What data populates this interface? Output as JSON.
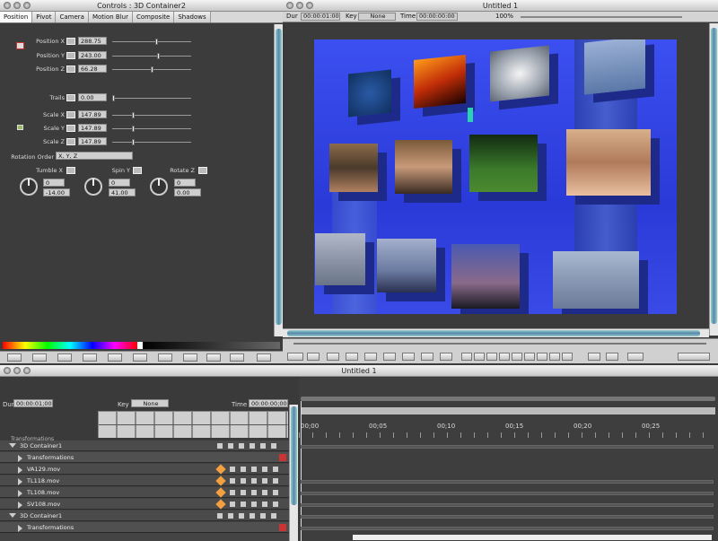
{
  "controls": {
    "title": "Controls : 3D Container2",
    "tabs": [
      "Position",
      "Pivot",
      "Camera",
      "Motion Blur",
      "Composite",
      "Shadows"
    ],
    "position_x_label": "Position X",
    "position_x": "288.75",
    "position_y_label": "Position Y",
    "position_y": "243.00",
    "position_z_label": "Position Z",
    "position_z": "66.28",
    "trails_label": "Trails",
    "trails": "0.00",
    "scale_x_label": "Scale X",
    "scale_x": "147.89",
    "scale_y_label": "Scale Y",
    "scale_y": "147.89",
    "scale_z_label": "Scale Z",
    "scale_z": "147.89",
    "rotation_order_label": "Rotation Order",
    "rotation_order": "X, Y, Z",
    "tumble_label": "Tumble X",
    "tumble_rev": "0",
    "tumble_deg": "-14.00",
    "spin_label": "Spin Y",
    "spin_rev": "0",
    "spin_deg": "41.00",
    "rotate_label": "Rotate Z",
    "rotate_rev": "0",
    "rotate_deg": "0.00"
  },
  "viewer": {
    "title": "Untitled 1",
    "dur_label": "Dur",
    "dur": "00:00:01:00",
    "key_label": "Key",
    "key": "None",
    "time_label": "Time",
    "time": "00:00:00:00",
    "zoom": "100%"
  },
  "timeline": {
    "title": "Untitled 1",
    "dur_label": "Dur",
    "dur": "00:00:01;00",
    "key_label": "Key",
    "key": "None",
    "time_label": "Time",
    "time": "00:00:00;00",
    "ticks": [
      "00;00",
      "00;05",
      "00;10",
      "00;15",
      "00;20",
      "00;25"
    ],
    "partial_label": "Transformations",
    "tracks": [
      {
        "name": "3D Container1",
        "indent": 1
      },
      {
        "name": "Transformations",
        "indent": 2
      },
      {
        "name": "VA129.mov",
        "indent": 2
      },
      {
        "name": "TL118.mov",
        "indent": 2
      },
      {
        "name": "TL108.mov",
        "indent": 2
      },
      {
        "name": "SV108.mov",
        "indent": 2
      },
      {
        "name": "3D Container1",
        "indent": 1
      },
      {
        "name": "Transformations",
        "indent": 2
      }
    ]
  }
}
